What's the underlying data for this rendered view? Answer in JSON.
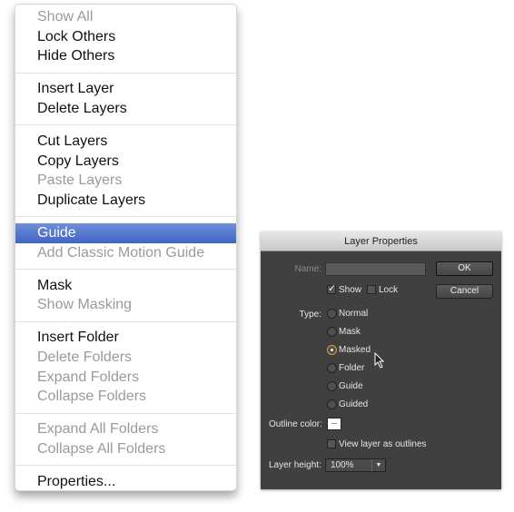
{
  "menu": {
    "groups": [
      [
        {
          "label": "Show All",
          "enabled": false
        },
        {
          "label": "Lock Others",
          "enabled": true
        },
        {
          "label": "Hide Others",
          "enabled": true
        }
      ],
      [
        {
          "label": "Insert Layer",
          "enabled": true
        },
        {
          "label": "Delete Layers",
          "enabled": true
        }
      ],
      [
        {
          "label": "Cut Layers",
          "enabled": true
        },
        {
          "label": "Copy Layers",
          "enabled": true
        },
        {
          "label": "Paste Layers",
          "enabled": false
        },
        {
          "label": "Duplicate Layers",
          "enabled": true
        }
      ],
      [
        {
          "label": "Guide",
          "enabled": true,
          "selected": true
        },
        {
          "label": "Add Classic Motion Guide",
          "enabled": false
        }
      ],
      [
        {
          "label": "Mask",
          "enabled": true
        },
        {
          "label": "Show Masking",
          "enabled": false
        }
      ],
      [
        {
          "label": "Insert Folder",
          "enabled": true
        },
        {
          "label": "Delete Folders",
          "enabled": false
        },
        {
          "label": "Expand Folders",
          "enabled": false
        },
        {
          "label": "Collapse Folders",
          "enabled": false
        }
      ],
      [
        {
          "label": "Expand All Folders",
          "enabled": false
        },
        {
          "label": "Collapse All Folders",
          "enabled": false
        }
      ],
      [
        {
          "label": "Properties...",
          "enabled": true
        }
      ]
    ]
  },
  "dialog": {
    "title": "Layer Properties",
    "name_label": "Name:",
    "name_value": "",
    "ok": "OK",
    "cancel": "Cancel",
    "show_label": "Show",
    "show_checked": true,
    "lock_label": "Lock",
    "lock_checked": false,
    "type_label": "Type:",
    "types": [
      "Normal",
      "Mask",
      "Masked",
      "Folder",
      "Guide",
      "Guided"
    ],
    "selected_type": "Masked",
    "outline_label": "Outline color:",
    "outline_swatch": "--",
    "outline_color": "#ffffff",
    "view_outlines_label": "View layer as outlines",
    "view_outlines_checked": false,
    "height_label": "Layer height:",
    "height_value": "100%"
  },
  "colors": {
    "highlight": "#3f64c4",
    "radio_selected": "#d9a333"
  }
}
